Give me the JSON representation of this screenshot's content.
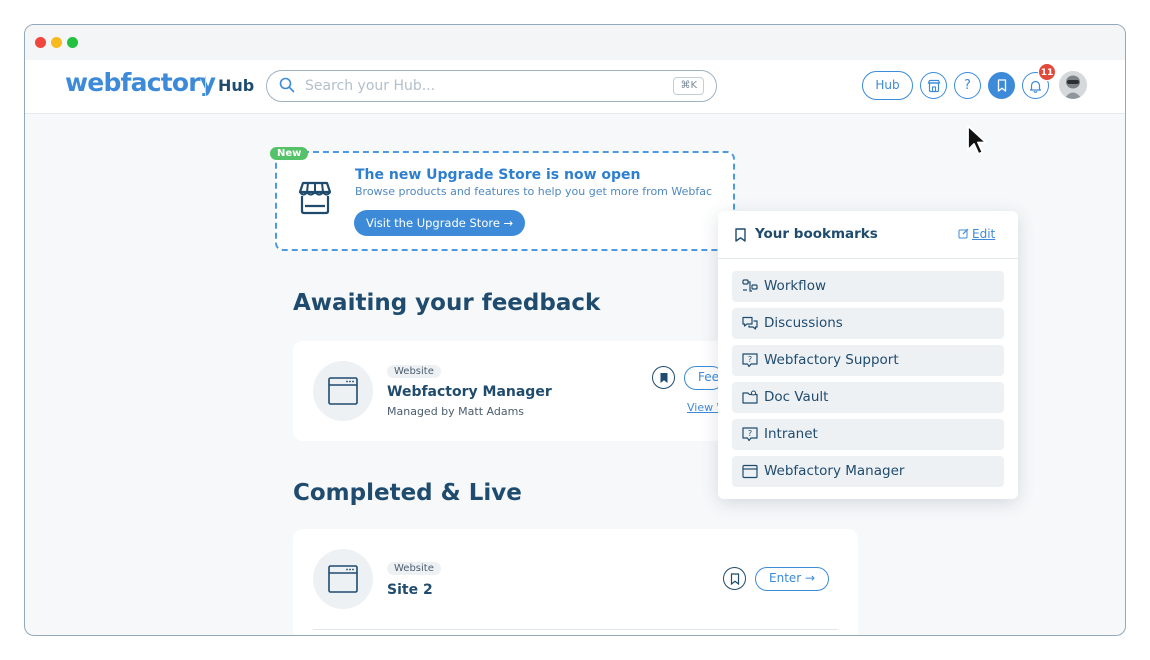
{
  "app": {
    "logo": "webfactory",
    "section": "Hub"
  },
  "search": {
    "placeholder": "Search your Hub...",
    "shortcut": "⌘K"
  },
  "nav": {
    "hub_label": "Hub",
    "notification_count": "11",
    "icons": [
      "store-icon",
      "help-icon",
      "bookmark-icon",
      "bell-icon",
      "avatar"
    ]
  },
  "promo": {
    "tag": "New",
    "title": "The new Upgrade Store is now open",
    "subtitle": "Browse products and features to help you get more from Webfac",
    "button": "Visit the Upgrade Store →"
  },
  "sections": {
    "awaiting": {
      "title": "Awaiting your feedback",
      "card": {
        "type": "Website",
        "name": "Webfactory Manager",
        "managed_by": "Managed by Matt Adams",
        "button": "Fee",
        "link": "View W"
      }
    },
    "completed": {
      "title": "Completed & Live",
      "card": {
        "type": "Website",
        "name": "Site 2",
        "button": "Enter →"
      }
    }
  },
  "bookmarks": {
    "title": "Your bookmarks",
    "edit": "Edit",
    "items": [
      {
        "label": "Workflow",
        "icon": "workflow-icon"
      },
      {
        "label": "Discussions",
        "icon": "chat-icon"
      },
      {
        "label": "Webfactory Support",
        "icon": "support-icon"
      },
      {
        "label": "Doc Vault",
        "icon": "folder-icon"
      },
      {
        "label": "Intranet",
        "icon": "support-icon"
      },
      {
        "label": "Webfactory Manager",
        "icon": "browser-icon"
      }
    ]
  },
  "colors": {
    "accent": "#3d8bd8",
    "heading": "#1f4b6e",
    "new_tag": "#55c168",
    "badge": "#e14a3a"
  }
}
